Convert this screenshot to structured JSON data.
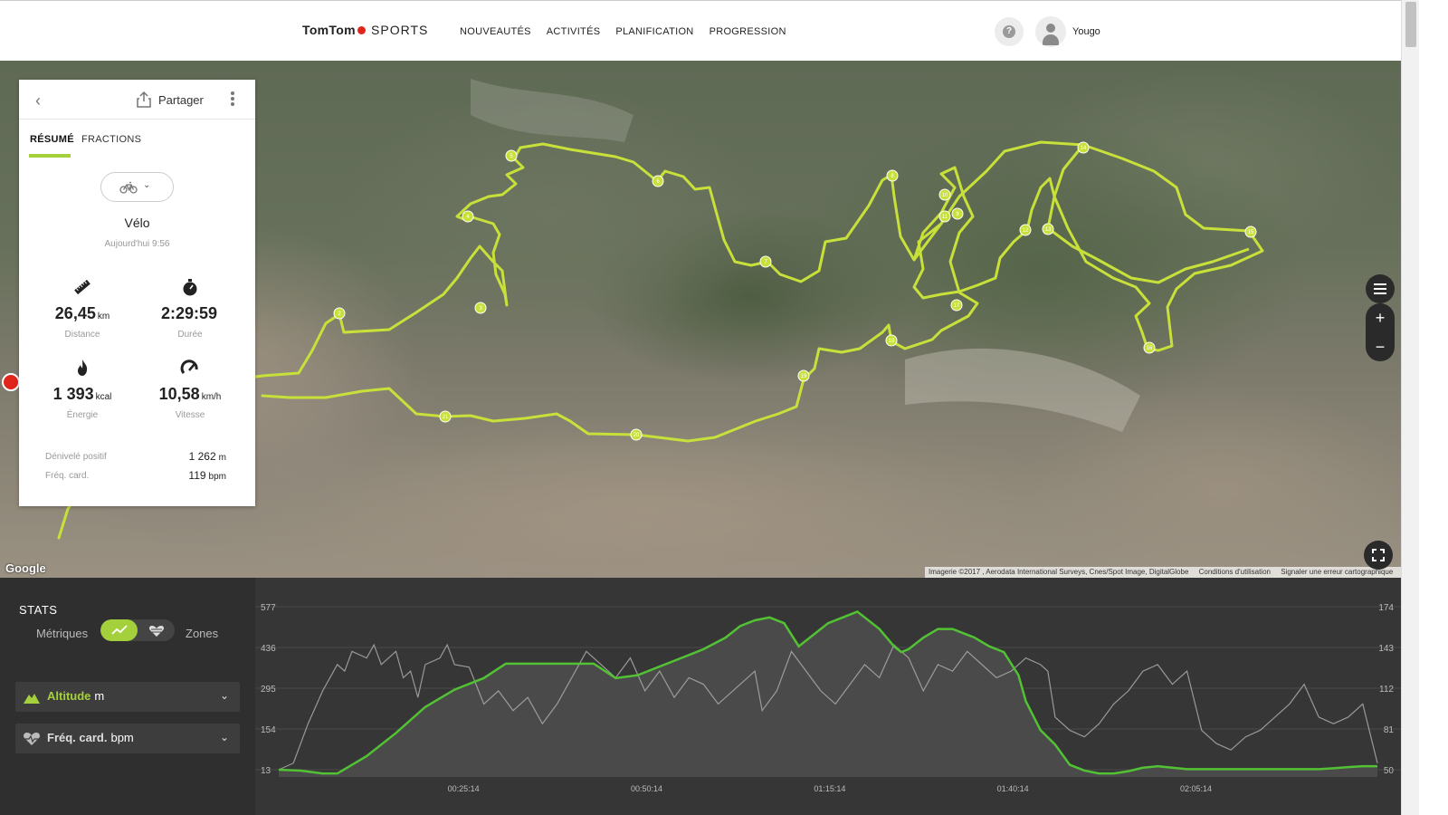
{
  "header": {
    "logo_brand": "TomTom",
    "logo_product": "SPORTS",
    "nav": [
      "NOUVEAUTÉS",
      "ACTIVITÉS",
      "PLANIFICATION",
      "PROGRESSION"
    ],
    "help_icon": "?",
    "username": "Yougo"
  },
  "activity_card": {
    "share_label": "Partager",
    "tabs": [
      "RÉSUMÉ",
      "FRACTIONS"
    ],
    "active_tab": "RÉSUMÉ",
    "sport_icon": "bike-icon",
    "activity_name": "Vélo",
    "activity_date": "Aujourd'hui 9:56",
    "stats": [
      {
        "icon": "ruler-icon",
        "value": "26,45",
        "unit": "km",
        "label": "Distance"
      },
      {
        "icon": "stopwatch-icon",
        "value": "2:29:59",
        "unit": "",
        "label": "Durée"
      },
      {
        "icon": "flame-icon",
        "value": "1 393",
        "unit": "kcal",
        "label": "Énergie"
      },
      {
        "icon": "speedometer-icon",
        "value": "10,58",
        "unit": "km/h",
        "label": "Vitesse"
      }
    ],
    "extra": [
      {
        "label": "Dénivelé positif",
        "value": "1 262",
        "unit": "m"
      },
      {
        "label": "Fréq. card.",
        "value": "119",
        "unit": "bpm"
      }
    ]
  },
  "map": {
    "provider_logo": "Google",
    "attribution": [
      "Imagerie ©2017 , Aerodata International Surveys, Cnes/Spot Image, DigitalGlobe",
      "Conditions d'utilisation",
      "Signaler une erreur cartographique"
    ],
    "route_color": "#c8e03a",
    "controls": {
      "zoom_in": "+",
      "zoom_out": "−"
    },
    "lap_markers": [
      "2",
      "3",
      "4",
      "5",
      "6",
      "7",
      "8",
      "9",
      "10",
      "11",
      "12",
      "13",
      "14",
      "15",
      "16",
      "17",
      "18",
      "19",
      "20",
      "21",
      "22",
      "23"
    ]
  },
  "stats_panel": {
    "title": "STATS",
    "toggle_left": "Métriques",
    "toggle_right": "Zones",
    "metrics": [
      {
        "icon": "mountain-icon",
        "label": "Altitude",
        "unit": "m",
        "color": "#a4d13b"
      },
      {
        "icon": "heart-icon",
        "label": "Fréq. card.",
        "unit": "bpm",
        "color": "#dddddd"
      }
    ]
  },
  "chart_data": {
    "type": "area",
    "x_ticks": [
      "00:25:14",
      "00:50:14",
      "01:15:14",
      "01:40:14",
      "02:05:14"
    ],
    "y_left_ticks": [
      "577",
      "436",
      "295",
      "154",
      "13"
    ],
    "y_right_ticks": [
      "174",
      "143",
      "112",
      "81",
      "50"
    ],
    "ylim_left": [
      13,
      577
    ],
    "ylim_right": [
      50,
      174
    ],
    "xlim_minutes": [
      0,
      150
    ],
    "grid": true,
    "series": [
      {
        "name": "Altitude",
        "unit": "m",
        "axis": "left",
        "color": "#52c234",
        "x": [
          0,
          3,
          6,
          8,
          12,
          16,
          20,
          24,
          28,
          31,
          34,
          37,
          40,
          43,
          46,
          49,
          52,
          55,
          58,
          61,
          63,
          65,
          67,
          69,
          71,
          73,
          75,
          77,
          79,
          80,
          82,
          84,
          85,
          86,
          88,
          90,
          92,
          94,
          95,
          97,
          99,
          101,
          102,
          103,
          104,
          106,
          108,
          110,
          112,
          114,
          116,
          118,
          120,
          122,
          124,
          126,
          128,
          130,
          132,
          134,
          136,
          138,
          140,
          142,
          144,
          146,
          148,
          150
        ],
        "y": [
          13,
          10,
          0,
          0,
          60,
          140,
          230,
          290,
          330,
          380,
          380,
          380,
          380,
          380,
          330,
          340,
          370,
          400,
          430,
          470,
          510,
          530,
          540,
          520,
          440,
          480,
          520,
          540,
          560,
          540,
          500,
          440,
          420,
          430,
          470,
          500,
          500,
          480,
          470,
          440,
          420,
          340,
          250,
          200,
          150,
          100,
          30,
          10,
          0,
          0,
          8,
          20,
          25,
          20,
          15,
          15,
          15,
          15,
          15,
          15,
          15,
          15,
          15,
          15,
          18,
          22,
          25,
          25
        ]
      },
      {
        "name": "Fréq. card.",
        "unit": "bpm",
        "axis": "right",
        "color": "#aaaaaa",
        "x": [
          0,
          2,
          4,
          6,
          8,
          9,
          10,
          12,
          13,
          14,
          16,
          17,
          18,
          19,
          20,
          22,
          23,
          24,
          26,
          28,
          30,
          32,
          34,
          36,
          38,
          40,
          42,
          44,
          46,
          48,
          50,
          52,
          54,
          56,
          58,
          60,
          62,
          64,
          65,
          66,
          68,
          70,
          72,
          74,
          76,
          78,
          80,
          82,
          84,
          86,
          88,
          90,
          92,
          94,
          96,
          98,
          100,
          102,
          104,
          105,
          106,
          108,
          110,
          112,
          114,
          116,
          118,
          120,
          122,
          124,
          126,
          128,
          130,
          132,
          134,
          136,
          138,
          140,
          142,
          144,
          146,
          148,
          150
        ],
        "y": [
          50,
          55,
          85,
          110,
          130,
          125,
          140,
          135,
          145,
          130,
          140,
          120,
          125,
          105,
          130,
          135,
          145,
          130,
          128,
          100,
          110,
          95,
          105,
          85,
          100,
          120,
          140,
          130,
          120,
          135,
          110,
          125,
          105,
          120,
          115,
          100,
          110,
          120,
          125,
          95,
          110,
          140,
          125,
          110,
          100,
          115,
          130,
          120,
          145,
          135,
          110,
          130,
          125,
          140,
          130,
          120,
          125,
          135,
          130,
          125,
          90,
          80,
          75,
          85,
          100,
          110,
          125,
          130,
          115,
          125,
          80,
          70,
          65,
          75,
          80,
          90,
          100,
          115,
          90,
          85,
          90,
          100,
          55
        ]
      }
    ]
  }
}
